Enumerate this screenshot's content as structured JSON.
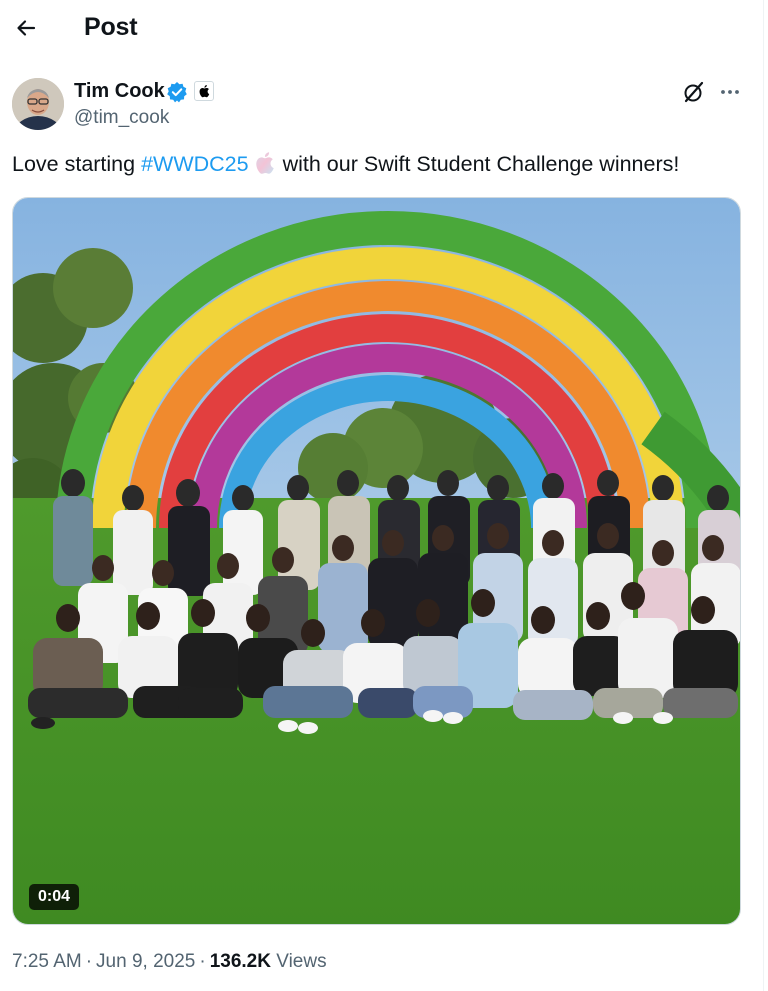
{
  "header": {
    "title": "Post",
    "back_icon": "arrow-left-icon"
  },
  "author": {
    "name": "Tim Cook",
    "handle": "@tim_cook",
    "verified": true,
    "verified_color": "#1d9bf0",
    "affiliate_icon": "apple-logo-icon"
  },
  "actions": {
    "grok_icon": "grok-icon",
    "more_icon": "more-dots-icon"
  },
  "post": {
    "text_before": "Love starting ",
    "hashtag": "#WWDC25",
    "hashflag_icon": "wwdc-apple-hashflag-icon",
    "text_after": "with our Swift Student Challenge winners!"
  },
  "media": {
    "type": "video",
    "duration": "0:04"
  },
  "meta": {
    "time": "7:25 AM",
    "date": "Jun 9, 2025",
    "views_count": "136.2K",
    "views_label": "Views"
  },
  "colors": {
    "link": "#1d9bf0",
    "text": "#0f1419",
    "secondary": "#536471"
  }
}
